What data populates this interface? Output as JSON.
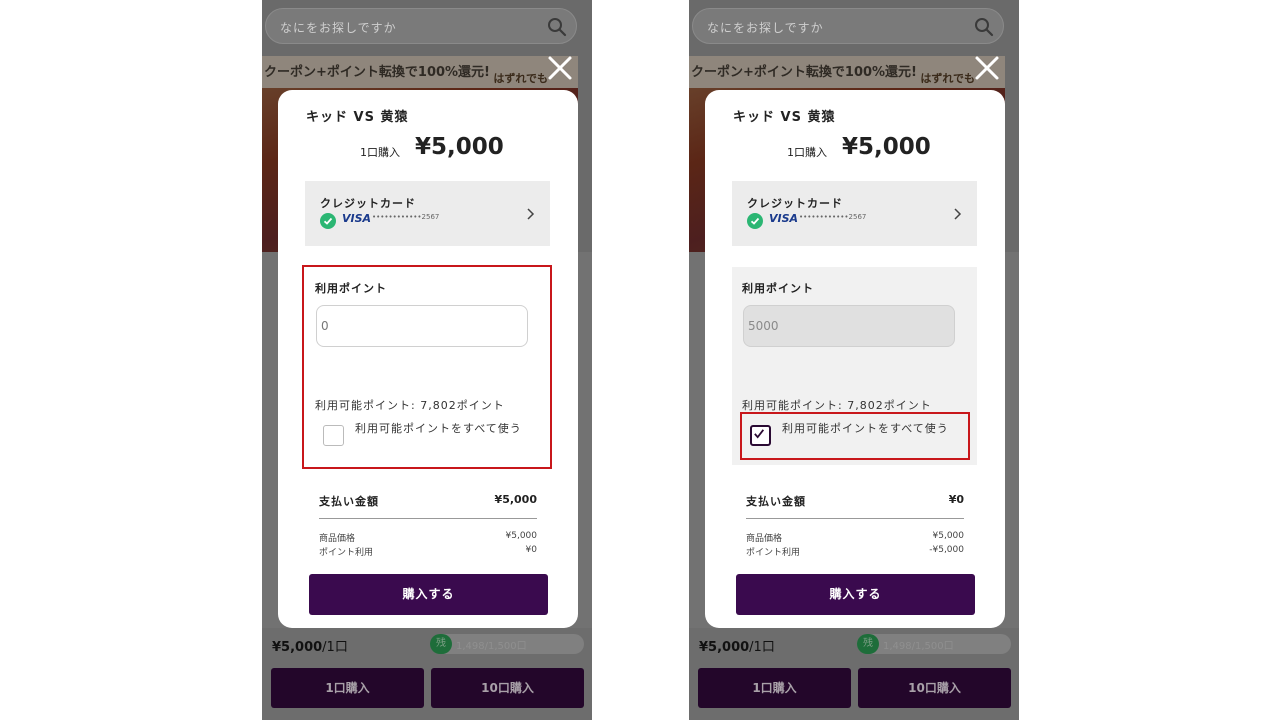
{
  "background": {
    "search_placeholder": "なにをお探しですか",
    "banner_text": "クーポン+ポイント転換で100%還元!",
    "banner_sub": "はずれでも"
  },
  "bottom": {
    "price": "¥5,000",
    "price_unit": "/1口",
    "stock_badge": "残",
    "stock_text": "1,498/1,500口",
    "buy_one": "1口購入",
    "buy_ten": "10口購入"
  },
  "modal": {
    "title": "キッド VS 黄猿",
    "quantity": "1口購入",
    "price": "¥5,000",
    "card_label": "クレジットカード",
    "card_brand": "VISA",
    "card_number": "••••••••••••2567",
    "points_label": "利用ポイント",
    "available_points": "利用可能ポイント: 7,802ポイント",
    "use_all_label": "利用可能ポイントをすべて使う",
    "payment_label": "支払い金額",
    "item_price_label": "商品価格",
    "point_use_label": "ポイント利用",
    "buy_button": "購入する"
  },
  "left": {
    "points_input_value": "0",
    "use_all_checked": false,
    "payment_amount": "¥5,000",
    "item_price": "¥5,000",
    "point_use": "¥0"
  },
  "right": {
    "points_input_value": "5000",
    "use_all_checked": true,
    "payment_amount": "¥0",
    "item_price": "¥5,000",
    "point_use": "-¥5,000"
  },
  "colors": {
    "accent": "#3a0a4e",
    "highlight_frame": "#c8171b",
    "check_green": "#2bb673"
  }
}
